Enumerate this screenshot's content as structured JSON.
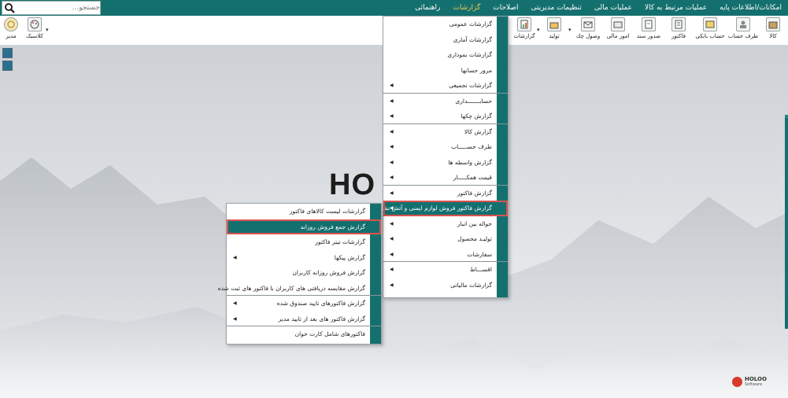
{
  "menubar": {
    "items": [
      {
        "label": "امکانات/اطلاعات پایه"
      },
      {
        "label": "عملیات مرتبط به کالا"
      },
      {
        "label": "عملیات مالی"
      },
      {
        "label": "تنظیمات مدیریتی"
      },
      {
        "label": "اصلاحات"
      },
      {
        "label": "گزارشات",
        "active": true
      },
      {
        "label": "راهنمائی"
      }
    ],
    "search_placeholder": "جستجو...",
    "search_value": "جستجو..."
  },
  "toolbar": {
    "buttons": [
      {
        "label": "کالا",
        "icon": "box-icon"
      },
      {
        "label": "طرف حساب",
        "icon": "person-icon"
      },
      {
        "label": "حساب بانکی",
        "icon": "bank-icon"
      },
      {
        "label": "فاکتور",
        "icon": "invoice-icon"
      },
      {
        "label": "صدور سند",
        "icon": "document-icon"
      },
      {
        "label": "امور مالی",
        "icon": "finance-icon"
      },
      {
        "label": "وصول چك",
        "icon": "check-icon"
      },
      {
        "label": "تولید",
        "icon": "production-icon"
      },
      {
        "label": "گزارشات",
        "icon": "report-icon"
      },
      {
        "label": "کلاسیک",
        "icon": "palette-icon"
      },
      {
        "label": "مدیر",
        "icon": "manager-icon"
      }
    ]
  },
  "reports_menu": {
    "items": [
      {
        "label": "گزارشات عمومی"
      },
      {
        "label": "گزارشات آماری"
      },
      {
        "label": "گزارشات نموداری"
      },
      {
        "label": "مرور حسابها"
      },
      {
        "label": "گزارشات تجمیعی",
        "sub": true,
        "sep": true
      },
      {
        "label": "حسابـــــــداری",
        "sub": true
      },
      {
        "label": "گزارش چکها",
        "sub": true,
        "sep": true
      },
      {
        "label": "گزارش کالا",
        "sub": true
      },
      {
        "label": "طرف حســـــاب",
        "sub": true
      },
      {
        "label": "گزارش واسطه ها",
        "sub": true
      },
      {
        "label": "قیمت همکـــــار",
        "sub": true,
        "sep": true
      },
      {
        "label": "گزارش فاکتور",
        "sub": true
      },
      {
        "label": "گزارش فاکتور فروش لوازم ایمنی و آتش نشانی",
        "sub": true,
        "highlight": true
      },
      {
        "label": "حواله بین انبار",
        "sub": true
      },
      {
        "label": "تولیـد محصول",
        "sub": true
      },
      {
        "label": "سفارشات",
        "sub": true,
        "sep": true
      },
      {
        "label": "اقســـاط",
        "sub": true
      },
      {
        "label": "گزارشات مالیاتی",
        "sub": true
      }
    ]
  },
  "safety_submenu": {
    "items": [
      {
        "label": "گزارشات لیست کالاهای فاکتور"
      },
      {
        "label": "گزارش جمع فروش روزانه",
        "highlight": true
      },
      {
        "label": "گزارشات تیتر فاکتور"
      },
      {
        "label": "گزارش پیکها",
        "sub": true
      },
      {
        "label": "گزارش فروش روزانه کاربران"
      },
      {
        "label": "گزارش مقایسه دریافتی های  کاربران با فاکتور های ثبت شده",
        "sep": true
      },
      {
        "label": "گزارش فاکتورهای تایید صندوق شده",
        "sub": true
      },
      {
        "label": "گزارش فاکتور های بعد از تایید مدیر",
        "sub": true,
        "sep": true
      },
      {
        "label": "فاکتورهای شامل کارت خوان"
      }
    ]
  },
  "background": {
    "logo_text": "HO"
  },
  "footer_logo": {
    "name": "HOLOO",
    "tagline": "Software"
  },
  "colors": {
    "brand": "#14706f",
    "active_menu": "#f2c94c",
    "highlight_border": "#d9534f"
  }
}
